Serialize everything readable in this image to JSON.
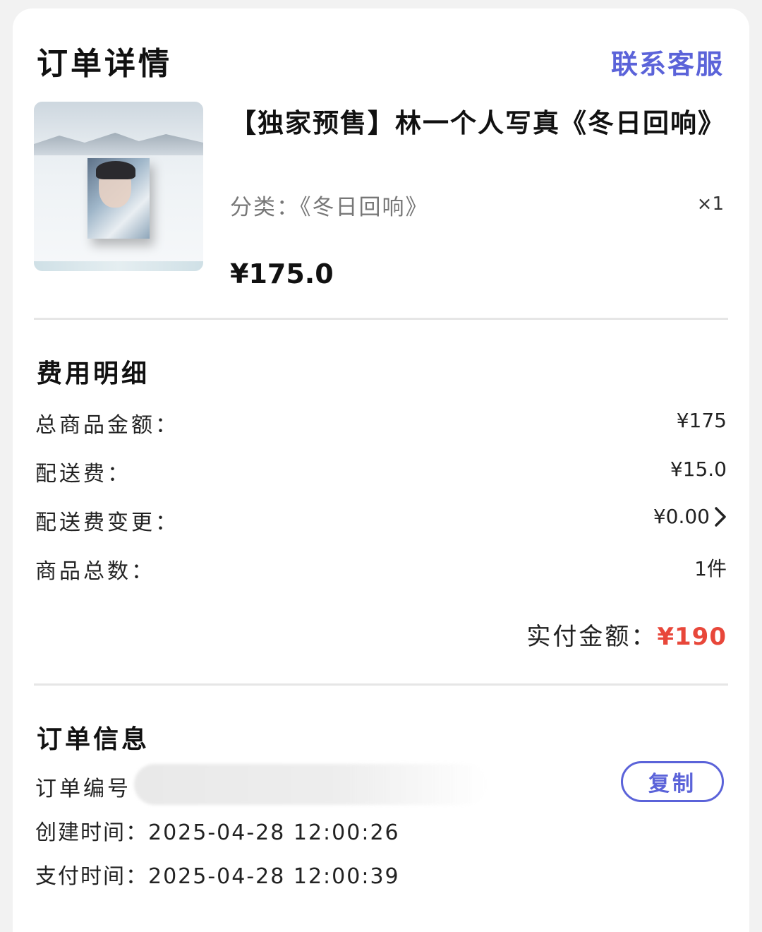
{
  "header": {
    "title": "订单详情",
    "contact_label": "联系客服"
  },
  "product": {
    "title": "【独家预售】林一个人写真《冬日回响》",
    "variant": "分类：《冬日回响》",
    "quantity": "×1",
    "price": "¥175.0",
    "image_icon": "product-thumbnail"
  },
  "fees": {
    "title": "费用明细",
    "rows": [
      {
        "label": "总商品金额：",
        "value": "¥175"
      },
      {
        "label": "配送费：",
        "value": "¥15.0"
      },
      {
        "label": "配送费变更：",
        "value": "¥0.00"
      },
      {
        "label": "商品总数：",
        "value": "1件"
      }
    ],
    "total_label": "实付金额：",
    "total_value": "¥190",
    "total_color": "#e8473a"
  },
  "order_info": {
    "title": "订单信息",
    "order_no_label": "订单编号",
    "copy_label": "复制",
    "created_label": "创建时间：",
    "created_value": "2025-04-28 12:00:26",
    "paid_label": "支付时间：",
    "paid_value": "2025-04-28 12:00:39"
  },
  "colors": {
    "accent": "#5b63d9",
    "price_red": "#e8473a",
    "background": "#f2f2f2"
  }
}
